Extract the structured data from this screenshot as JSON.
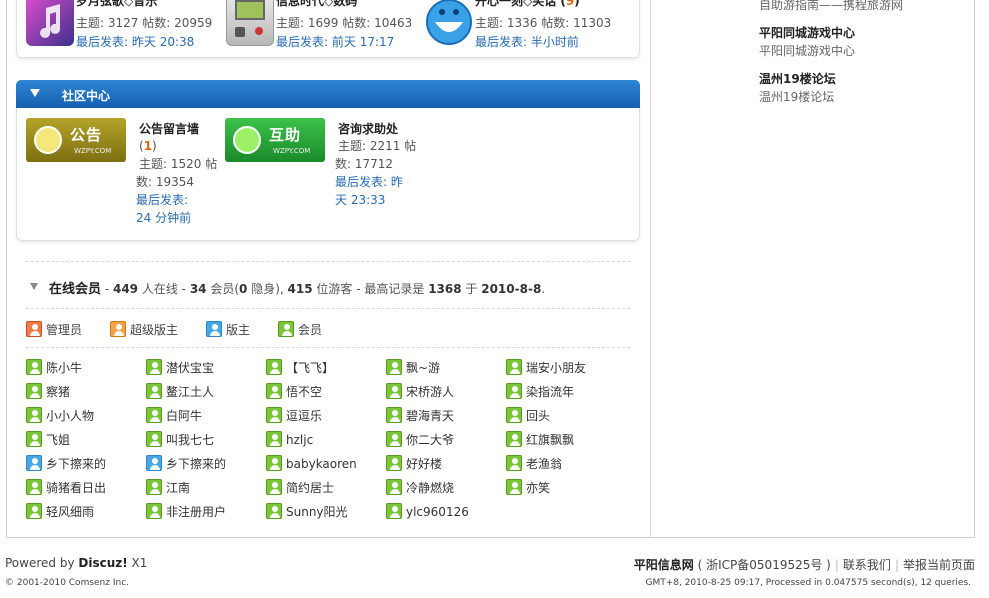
{
  "top_forums": [
    {
      "title": "岁月弦歌◇音乐",
      "stats": "主题: 3127 帖数: 20959",
      "last_label": "最后发表:",
      "last_time": "昨天 20:38",
      "icon": "music-icon"
    },
    {
      "title": "信息时代◇数码",
      "stats": "主题: 1699 帖数: 10463",
      "last_label": "最后发表:",
      "last_time": "前天 17:17",
      "icon": "gameboy-icon"
    },
    {
      "title": "开心一刻◇笑话",
      "new_count": "9",
      "stats": "主题: 1336 帖数: 11303",
      "last_label": "最后发表:",
      "last_time": "半小时前",
      "icon": "smiley-icon"
    }
  ],
  "community": {
    "header": "社区中心",
    "forums": [
      {
        "badge": "公告",
        "badge_sub": "WZPY.COM",
        "title": "公告留言墙",
        "new_count": "1",
        "stats1": "主题: 1520 帖",
        "stats2": "数: 19354",
        "last1": "最后发表:",
        "last2": "24 分钟前"
      },
      {
        "badge": "互助",
        "badge_sub": "WZPY.COM",
        "title": "咨询求助处",
        "stats1": "主题: 2211 帖",
        "stats2": "数: 17712",
        "last1": "最后发表: 昨",
        "last2": "天 23:33"
      }
    ]
  },
  "online": {
    "title": "在线会员",
    "summary_prefix": " - ",
    "total": "449",
    "total_label": " 人在线 - ",
    "members": "34",
    "members_label": " 会员(",
    "hidden": "0",
    "hidden_label": " 隐身), ",
    "guests": "415",
    "guests_label": " 位游客 - 最高记录是 ",
    "record": "1368",
    "record_label": " 于 ",
    "record_date": "2010-8-8",
    "end": "."
  },
  "legend": [
    {
      "label": "管理员",
      "color": "#f07a4a"
    },
    {
      "label": "超级版主",
      "color": "#f5a24a"
    },
    {
      "label": "版主",
      "color": "#49a7e6"
    },
    {
      "label": "会员",
      "color": "#7cc43a"
    }
  ],
  "members": [
    [
      "陈小牛",
      "潜伏宝宝",
      "【飞飞】",
      "飘~游",
      "瑞安小朋友"
    ],
    [
      "察猪",
      "鳌江土人",
      "悟不空",
      "宋桥游人",
      "染指流年"
    ],
    [
      "小小人物",
      "白阿牛",
      "逗逗乐",
      "碧海青天",
      "回头"
    ],
    [
      "飞姐",
      "叫我七七",
      "hzljc",
      "你二大爷",
      "红旗飘飘"
    ],
    [
      "乡下擦来的",
      "乡下擦来的",
      "babykaoren",
      "好好楼",
      "老渔翁"
    ],
    [
      "骑猪看日出",
      "江南",
      "简约居士",
      "冷静燃烧",
      "亦笑"
    ],
    [
      "轻风细雨",
      "非注册用户",
      "Sunny阳光",
      "ylc960126",
      ""
    ]
  ],
  "member_types": [
    [
      "green",
      "green",
      "green",
      "green",
      "green"
    ],
    [
      "green",
      "green",
      "green",
      "green",
      "green"
    ],
    [
      "green",
      "green",
      "green",
      "green",
      "green"
    ],
    [
      "green",
      "green",
      "green",
      "green",
      "green"
    ],
    [
      "blue",
      "blue",
      "green",
      "green",
      "green"
    ],
    [
      "green",
      "green",
      "green",
      "green",
      "green"
    ],
    [
      "green",
      "green",
      "green",
      "green",
      ""
    ]
  ],
  "sidebar": {
    "top_sub": "自助游指南——携程旅游网",
    "links": [
      {
        "title": "平阳同城游戏中心",
        "sub": "平阳同城游戏中心"
      },
      {
        "title": "温州19楼论坛",
        "sub": "温州19楼论坛"
      }
    ]
  },
  "footer": {
    "powered_prefix": "Powered by ",
    "product": "Discuz!",
    "version": " X1",
    "copyright": "© 2001-2010 Comsenz Inc.",
    "site_name": "平阳信息网",
    "icp": "( 浙ICP备05019525号 )",
    "contact": "联系我们",
    "report": "举报当前页面",
    "server_info": "GMT+8, 2010-8-25 09:17, Processed in 0.047575 second(s), 12 queries."
  }
}
